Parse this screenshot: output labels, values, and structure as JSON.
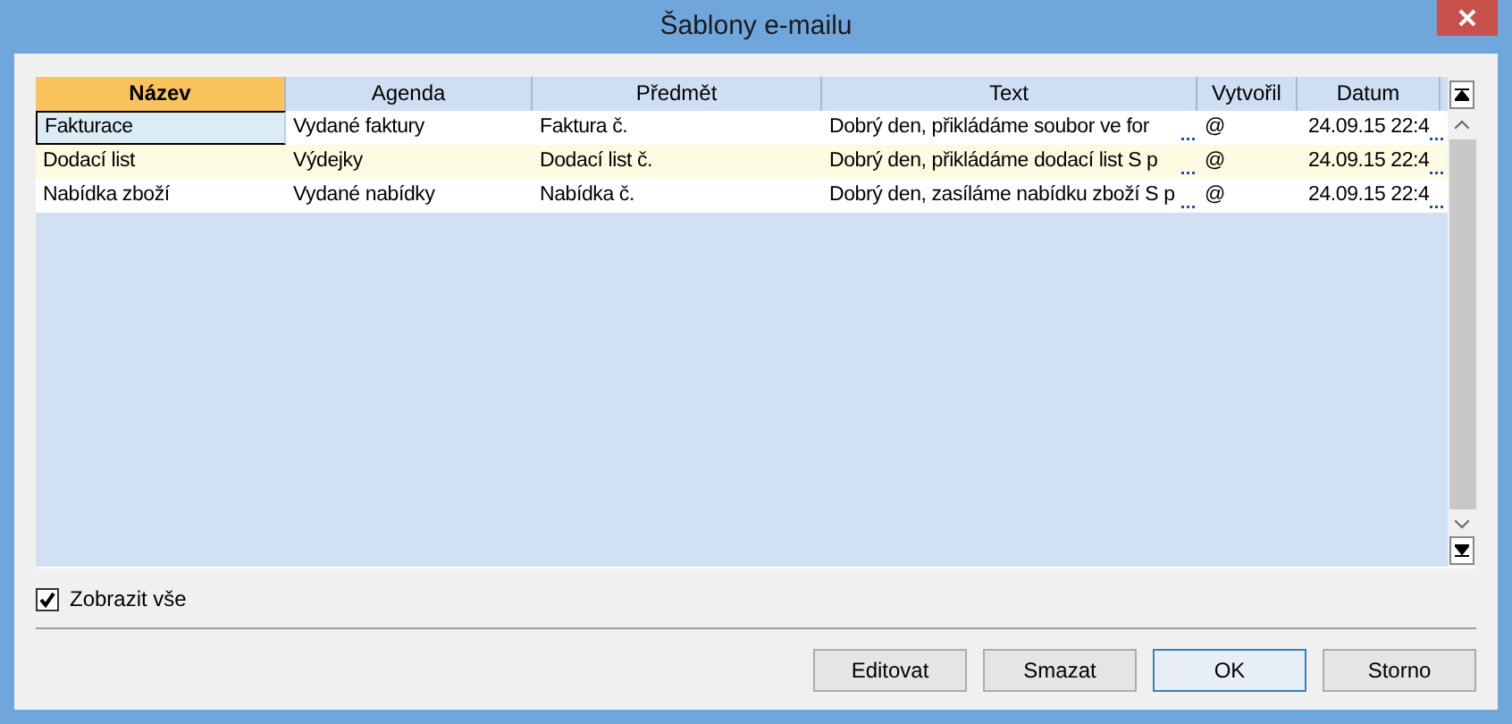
{
  "window": {
    "title": "Šablony e-mailu"
  },
  "table": {
    "columns": [
      {
        "label": "Název",
        "selected": true
      },
      {
        "label": "Agenda",
        "selected": false
      },
      {
        "label": "Předmět",
        "selected": false
      },
      {
        "label": "Text",
        "selected": false
      },
      {
        "label": "Vytvořil",
        "selected": false
      },
      {
        "label": "Datum",
        "selected": false
      }
    ],
    "rows": [
      {
        "selected": true,
        "cells": [
          "Fakturace",
          "Vydané faktury",
          "Faktura č.",
          "Dobrý den, přikládáme soubor ve for",
          "@",
          "24.09.15 22:4"
        ]
      },
      {
        "selected": false,
        "cells": [
          "Dodací list",
          "Výdejky",
          "Dodací list č.",
          "Dobrý den, přikládáme dodací list  S p",
          "@",
          "24.09.15 22:4"
        ]
      },
      {
        "selected": false,
        "cells": [
          "Nabídka zboží",
          "Vydané nabídky",
          "Nabídka č.",
          "Dobrý den, zasíláme nabídku zboží S p",
          "@",
          "24.09.15 22:4"
        ]
      }
    ]
  },
  "show_all": {
    "label": "Zobrazit vše",
    "checked": true
  },
  "buttons": [
    {
      "label": "Editovat",
      "default": false
    },
    {
      "label": "Smazat",
      "default": false
    },
    {
      "label": "OK",
      "default": true
    },
    {
      "label": "Storno",
      "default": false
    }
  ]
}
